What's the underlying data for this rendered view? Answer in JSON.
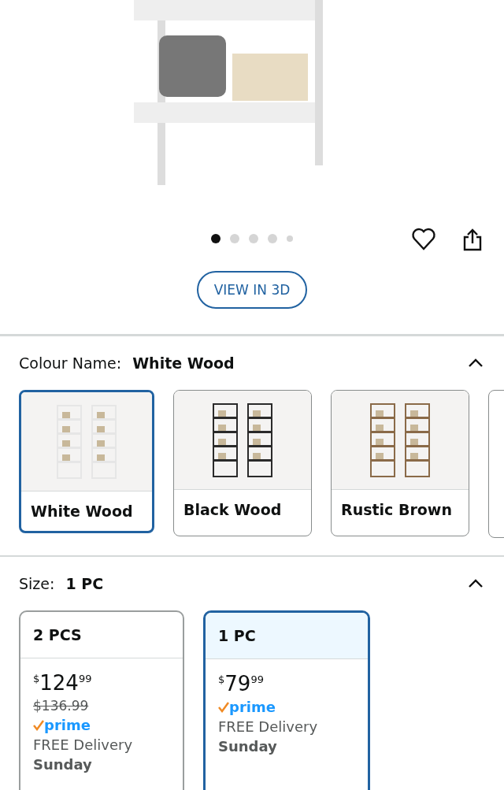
{
  "gallery": {
    "dots": [
      {
        "selected": true
      },
      {
        "selected": false
      },
      {
        "selected": false
      },
      {
        "selected": false
      },
      {
        "selected": false
      }
    ],
    "view_3d_button": "VIEW IN 3D"
  },
  "colour": {
    "label": "Colour Name:",
    "value": "White Wood",
    "expanded": true,
    "swatches": [
      {
        "label": "White Wood",
        "selected": true,
        "color": "#e6e6e6"
      },
      {
        "label": "Black Wood",
        "selected": false,
        "color": "#2a2a2a"
      },
      {
        "label": "Rustic Brown",
        "selected": false,
        "color": "#8a6a48"
      }
    ]
  },
  "size": {
    "label": "Size:",
    "value": "1 PC",
    "expanded": true,
    "options": [
      {
        "label": "2 PCS",
        "selected": false,
        "currency": "$",
        "whole": "124",
        "fraction": "99",
        "was_price": "$136.99",
        "prime": "prime",
        "delivery": "FREE Delivery",
        "day": "Sunday"
      },
      {
        "label": "1 PC",
        "selected": true,
        "currency": "$",
        "whole": "79",
        "fraction": "99",
        "prime": "prime",
        "delivery": "FREE Delivery",
        "day": "Sunday"
      }
    ]
  }
}
